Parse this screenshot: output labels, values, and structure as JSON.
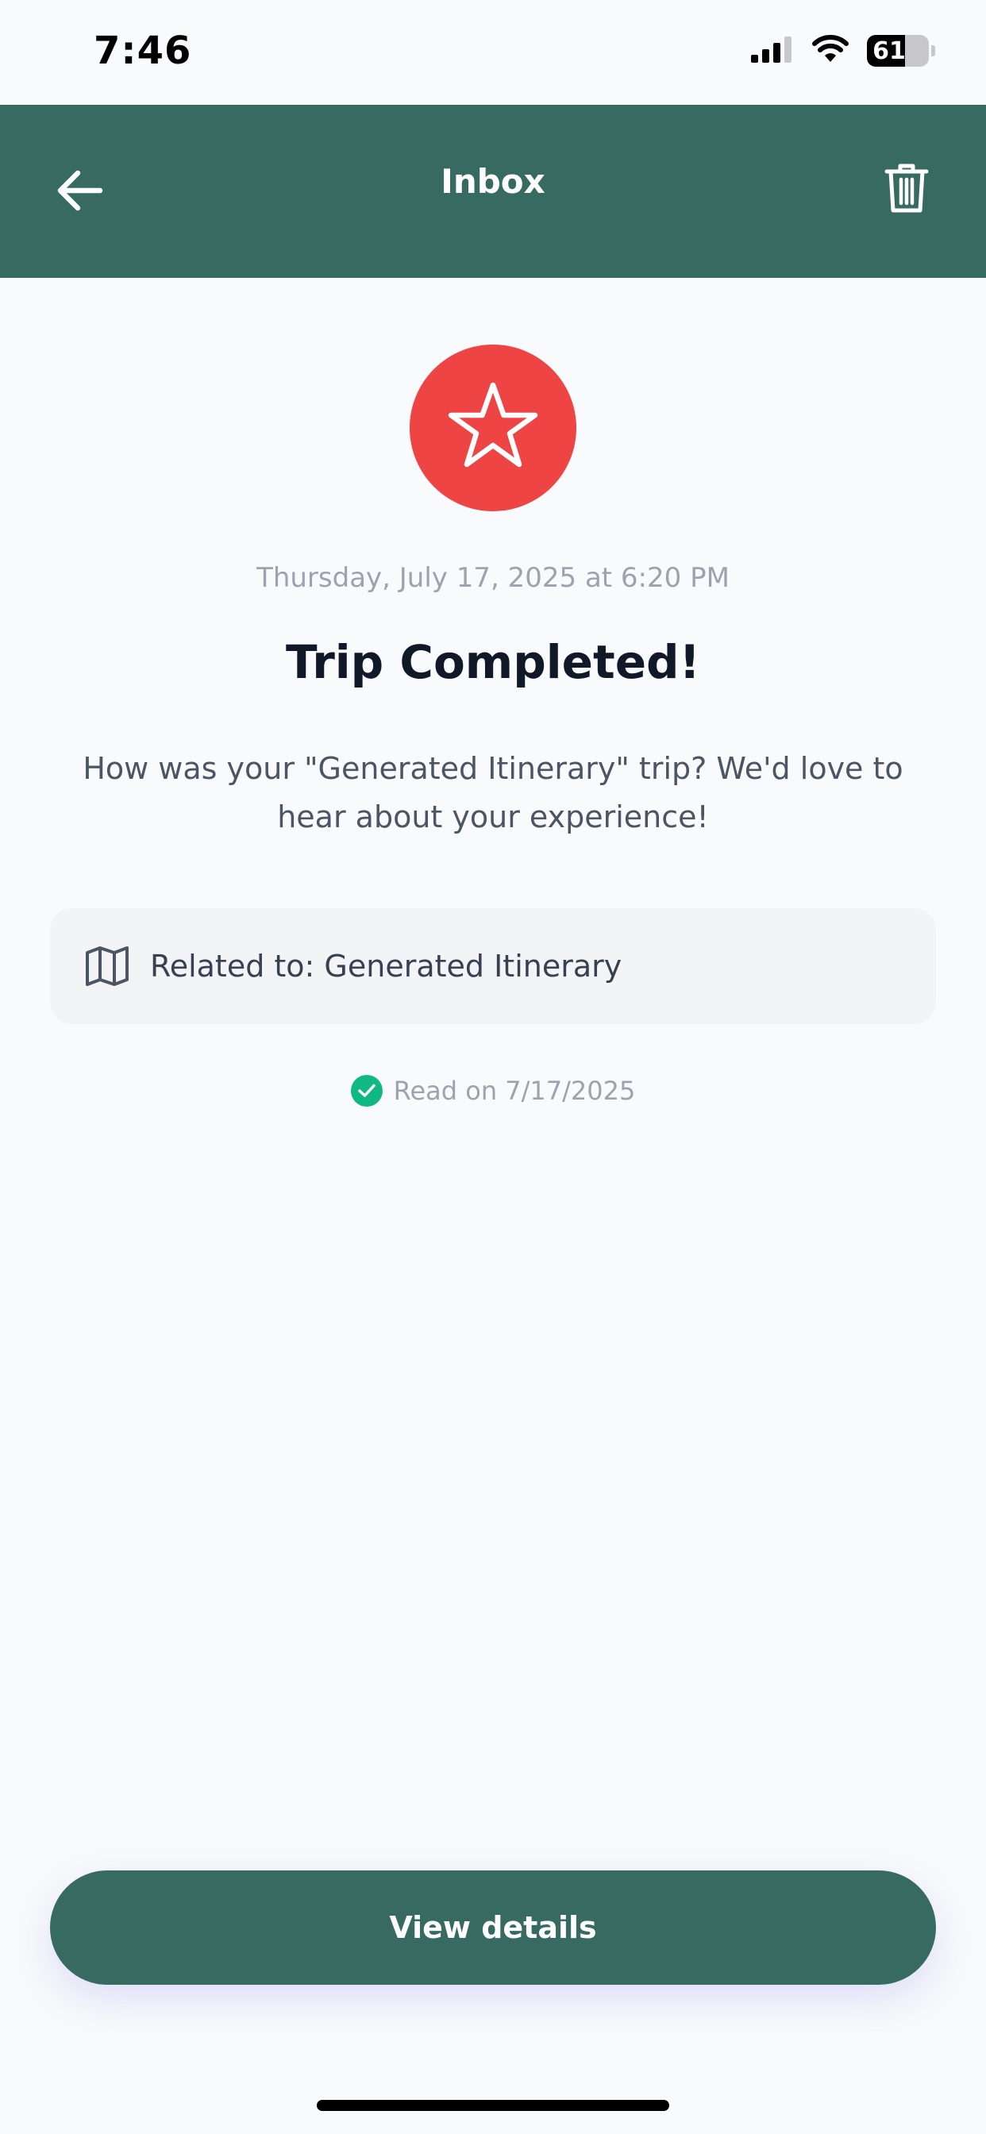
{
  "status_bar": {
    "time": "7:46",
    "battery_level": "61",
    "battery_fraction": 0.61
  },
  "header": {
    "title": "Inbox",
    "background_color": "#376b62"
  },
  "notification": {
    "icon": "star-icon",
    "icon_background_color": "#ef4444",
    "timestamp": "Thursday, July 17, 2025 at 6:20 PM",
    "title": "Trip Completed!",
    "message": "How was your \"Generated Itinerary\" trip? We'd love to hear about your experience!",
    "related": {
      "icon": "map-icon",
      "label": "Related to: Generated Itinerary"
    },
    "read_status": {
      "icon": "check-circle-icon",
      "label": "Read on 7/17/2025",
      "color": "#10b981"
    }
  },
  "actions": {
    "view_details_label": "View details"
  }
}
